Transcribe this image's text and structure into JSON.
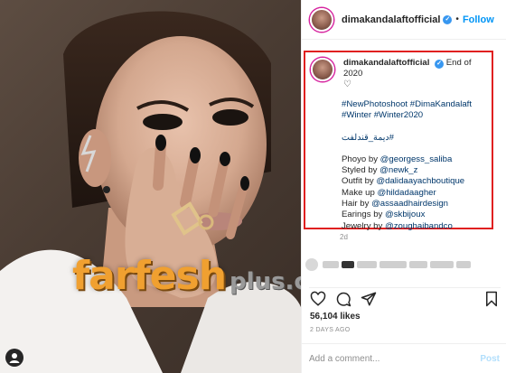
{
  "header": {
    "username": "dimakandalaftofficial",
    "dot": "•",
    "follow_label": "Follow"
  },
  "caption": {
    "username": "dimakandalaftofficial",
    "title_text": "End of 2020",
    "heart": "♡",
    "hashtags_line1": "#NewPhotoshoot #DimaKandalaft",
    "hashtags_line2": "#Winter #Winter2020",
    "arabic_tag": "#ديمة_قندلفت",
    "credits": [
      {
        "label": "Phoyo by ",
        "handle": "@georgess_saliba"
      },
      {
        "label": "Styled by ",
        "handle": "@newk_z"
      },
      {
        "label": "Outfit by ",
        "handle": "@dalidaayachboutique"
      },
      {
        "label": "Make up ",
        "handle": "@hildadaagher"
      },
      {
        "label": "Hair by ",
        "handle": "@assaadhairdesign"
      },
      {
        "label": "Earings by ",
        "handle": "@skbijoux"
      },
      {
        "label": "Jewelry by ",
        "handle": "@zoughaibandco"
      }
    ],
    "age": "2d"
  },
  "stats": {
    "likes": "56,104 likes",
    "date": "2 DAYS AGO"
  },
  "comment": {
    "placeholder": "Add a comment...",
    "post_label": "Post"
  },
  "watermark": {
    "main": "farfesh",
    "suffix": "plus.com"
  },
  "icons": {
    "verified": "verified-badge-icon",
    "like": "heart-icon",
    "comment": "comment-bubble-icon",
    "share": "paper-plane-icon",
    "save": "bookmark-icon",
    "tag": "user-tag-icon"
  },
  "colors": {
    "accent": "#0095f6",
    "highlight_border": "#e02020",
    "link": "#00376b"
  }
}
